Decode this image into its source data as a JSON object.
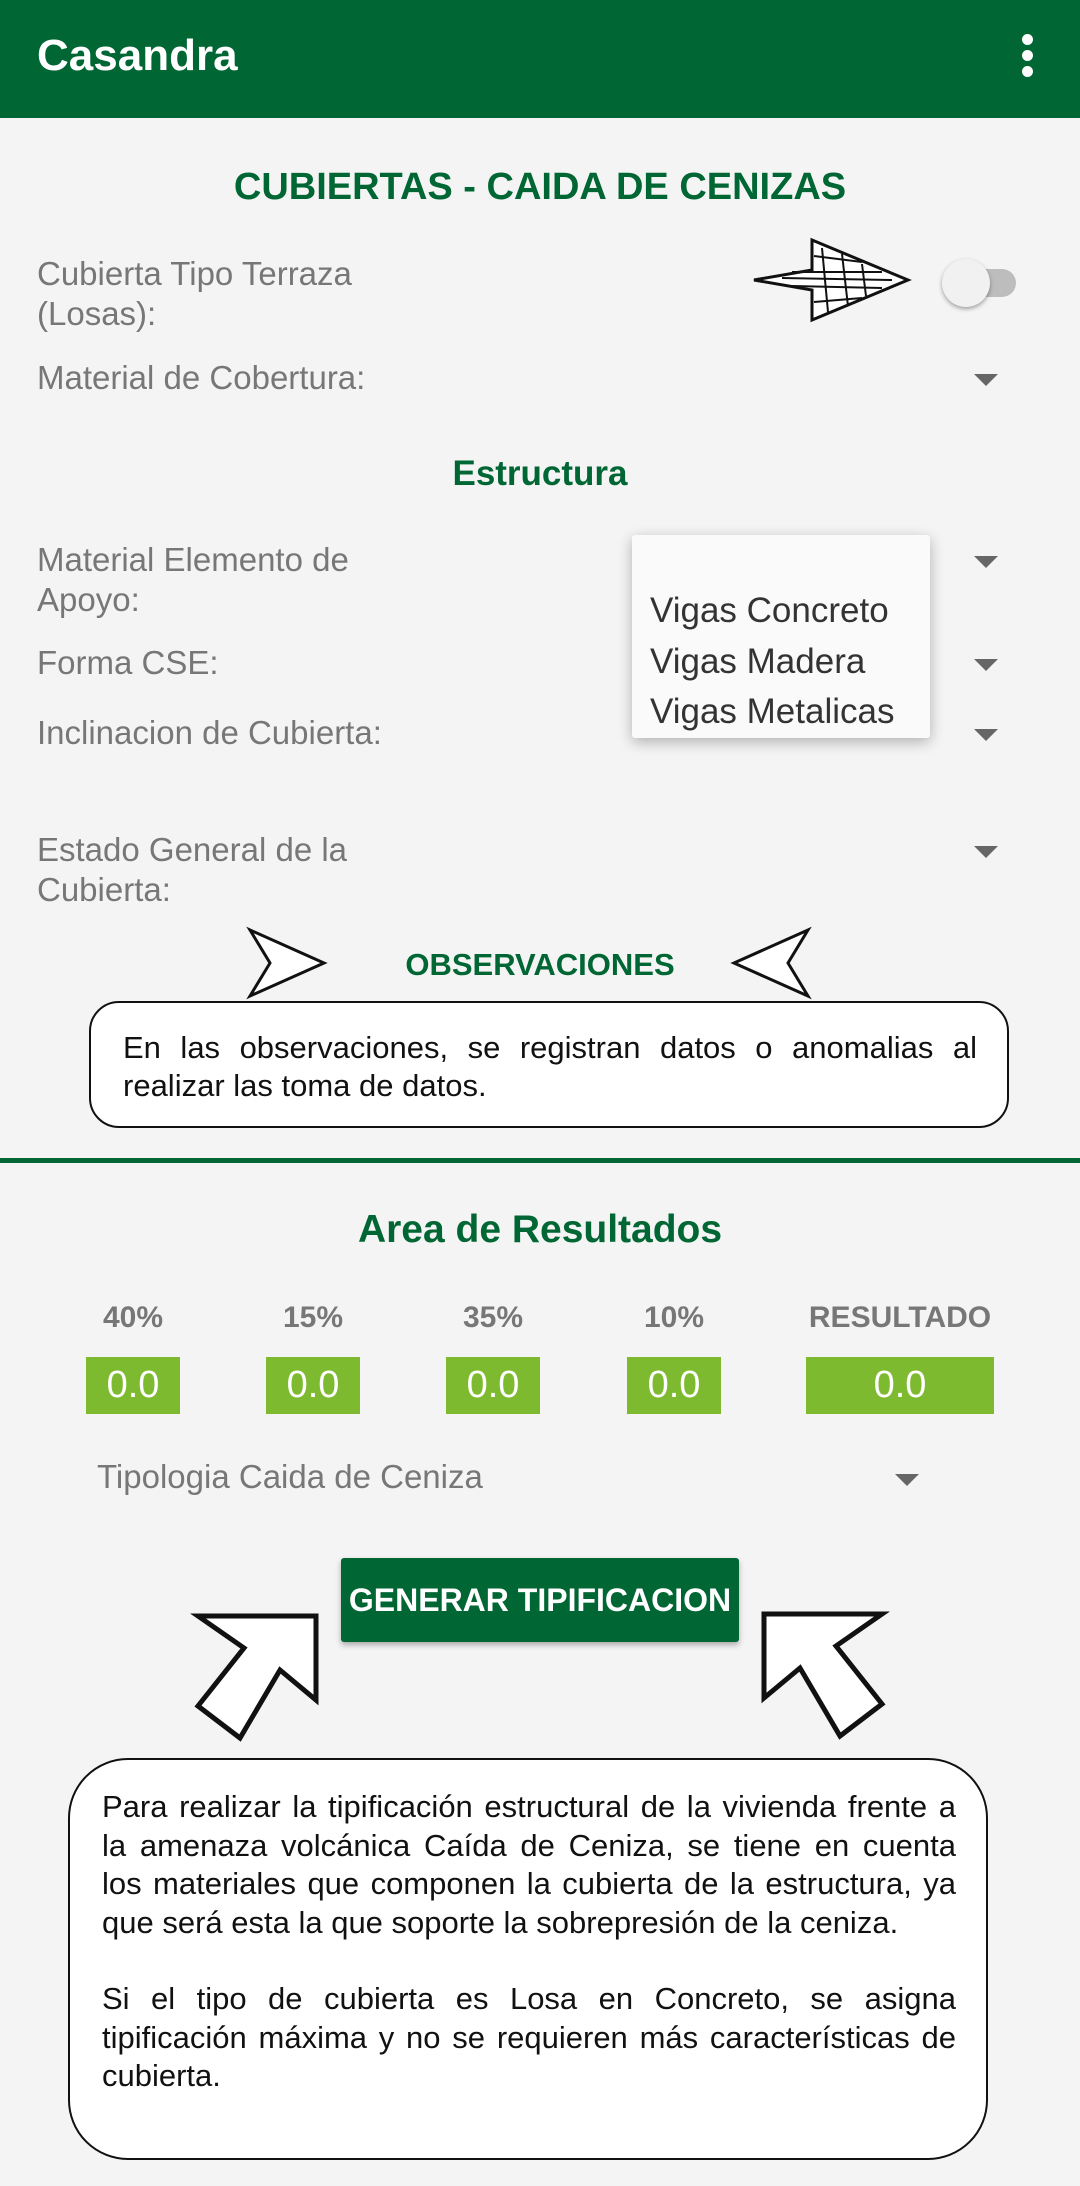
{
  "app_bar": {
    "title": "Casandra",
    "menu_icon": "more-vert-icon"
  },
  "form": {
    "section_title": "CUBIERTAS - CAIDA DE CENIZAS",
    "terraza_label": "Cubierta Tipo Terraza (Losas):",
    "terraza_toggle_on": false,
    "material_cobertura_label": "Material de Cobertura:",
    "estructura_title": "Estructura",
    "material_apoyo_label": "Material Elemento de Apoyo:",
    "forma_cse_label": "Forma CSE:",
    "inclinacion_label": "Inclinacion de Cubierta:",
    "estado_general_label": "Estado General de la Cubierta:"
  },
  "dropdown_popup": {
    "options": [
      "Vigas Concreto",
      "Vigas Madera",
      "Vigas Metalicas"
    ]
  },
  "observaciones": {
    "title": "OBSERVACIONES",
    "note": "En las observaciones, se registran datos o anomalias al realizar las toma de datos."
  },
  "results": {
    "title": "Area de Resultados",
    "columns": [
      {
        "label": "40%",
        "value": "0.0"
      },
      {
        "label": "15%",
        "value": "0.0"
      },
      {
        "label": "35%",
        "value": "0.0"
      },
      {
        "label": "10%",
        "value": "0.0"
      },
      {
        "label": "RESULTADO",
        "value": "0.0"
      }
    ],
    "tipologia_placeholder": "Tipologia Caida de Ceniza",
    "generate_button": "GENERAR TIPIFICACION"
  },
  "info_note": {
    "paragraph1": "Para realizar la tipificación estructural de la vivienda frente a la amenaza volcánica Caída de Ceniza, se tiene en cuenta los materiales que componen la cubierta de la estructura, ya que será esta la que soporte la sobrepresión de la ceniza.",
    "paragraph2": "Si el tipo de cubierta es Losa en Concreto, se asigna tipificación máxima y no se requieren más características de cubierta."
  },
  "colors": {
    "app_bar": "#006633",
    "accent_green": "#006633",
    "result_box": "#7dba2f",
    "background": "#f4f4f4"
  }
}
